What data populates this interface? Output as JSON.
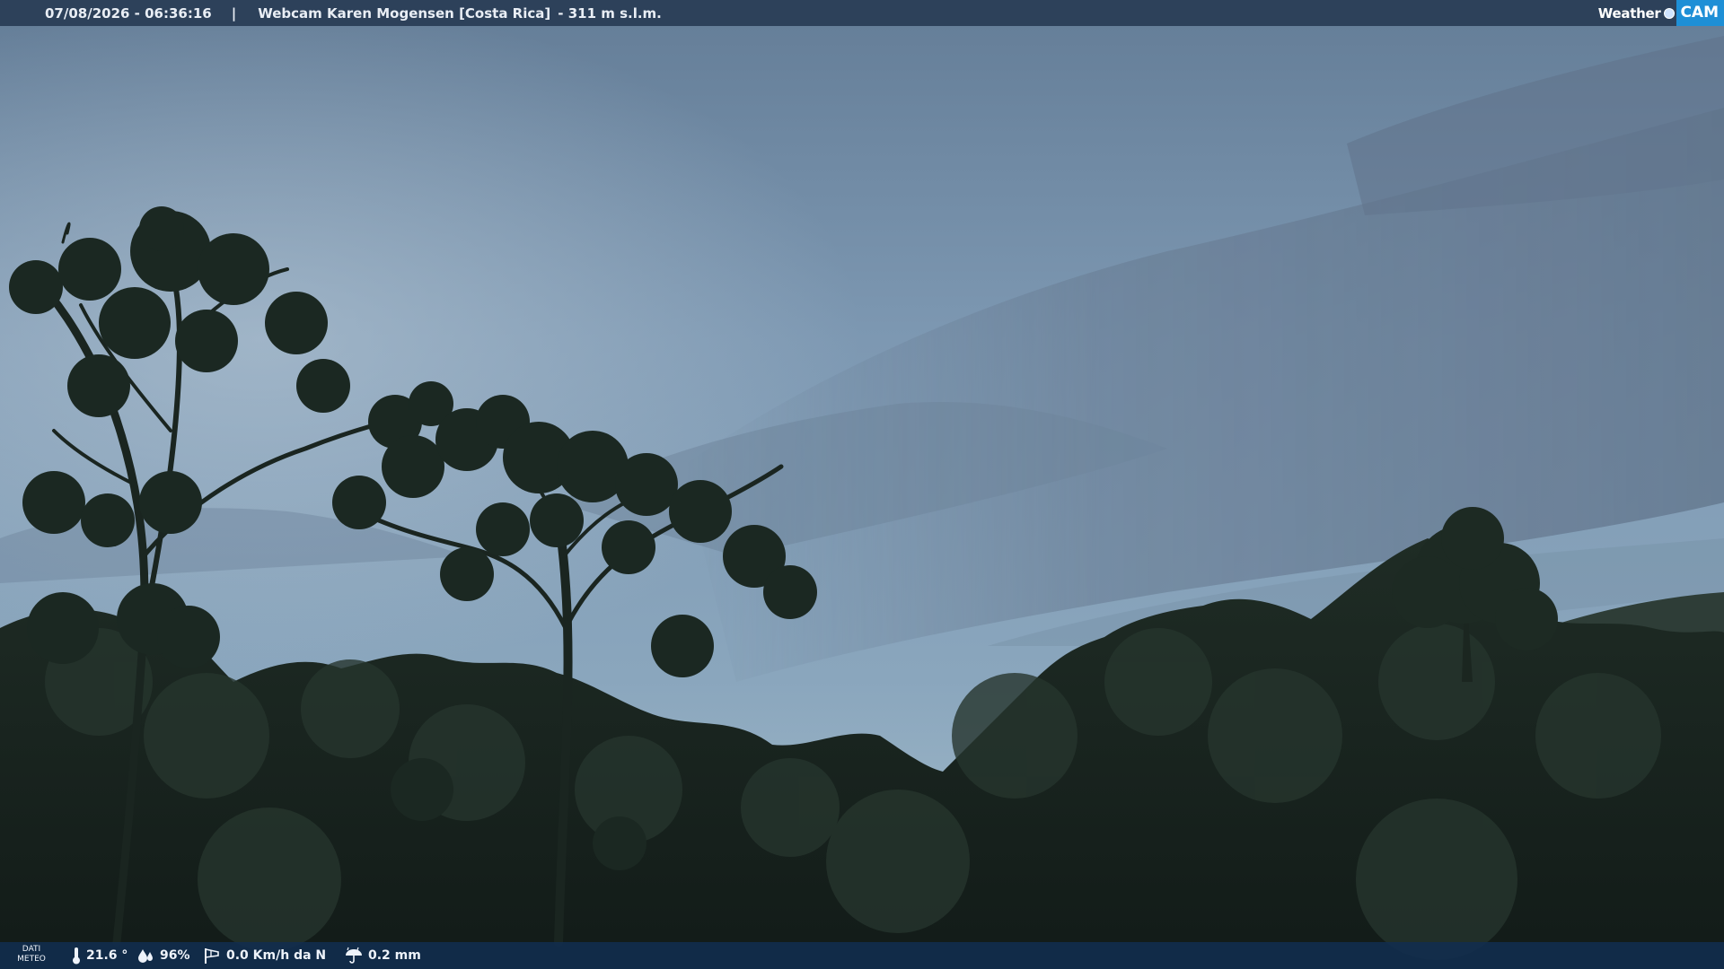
{
  "header": {
    "timestamp": "07/08/2026 - 06:36:16",
    "separator": "|",
    "camera_name": "Webcam Karen Mogensen [Costa Rica]",
    "altitude": "- 311 m s.l.m.",
    "brand_weather": "Weather",
    "brand_cam": "CAM"
  },
  "footer": {
    "label_line1": "DATI",
    "label_line2": "METEO",
    "temperature": "21.6 °",
    "humidity": "96%",
    "wind": "0.0 Km/h da N",
    "rain": "0.2 mm"
  },
  "icons": {
    "temperature": "thermometer-icon",
    "humidity": "humidity-drops-icon",
    "wind": "wind-sock-icon",
    "rain": "rain-umbrella-icon"
  },
  "colors": {
    "header_bg": "#283c55",
    "footer_bg": "#122d4e",
    "brand_accent": "#1e8fd6",
    "text": "#e9eef5"
  }
}
